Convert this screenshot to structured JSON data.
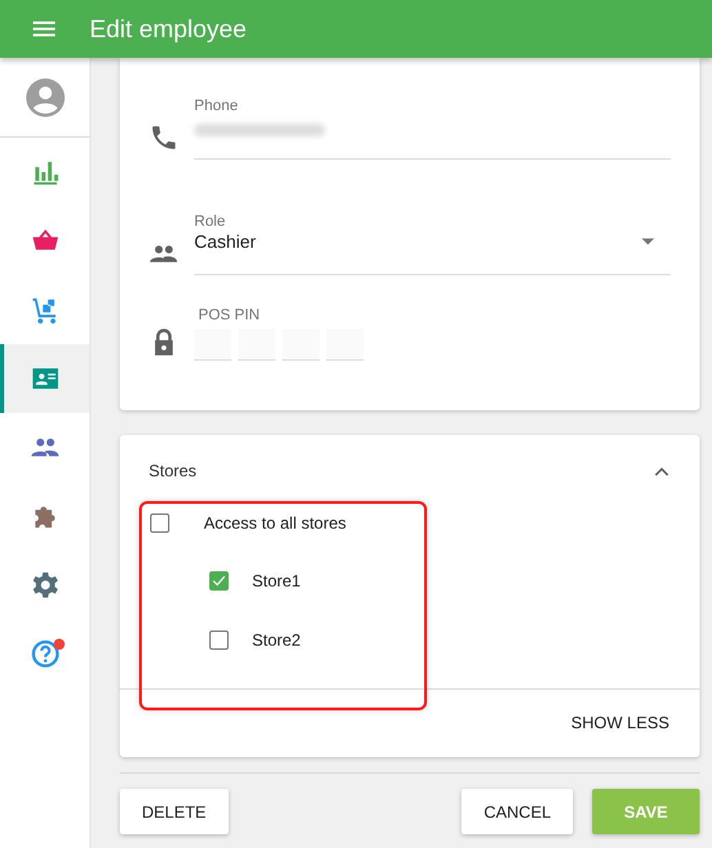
{
  "app_bar": {
    "title": "Edit employee"
  },
  "sidebar": {
    "items": [
      {
        "selected": false,
        "notification": false
      },
      {
        "selected": false,
        "notification": false
      },
      {
        "selected": false,
        "notification": false
      },
      {
        "selected": true,
        "notification": false
      },
      {
        "selected": false,
        "notification": false
      },
      {
        "selected": false,
        "notification": false
      },
      {
        "selected": false,
        "notification": false
      },
      {
        "selected": false,
        "notification": true
      }
    ]
  },
  "details_card": {
    "phone": {
      "label": "Phone"
    },
    "role": {
      "label": "Role",
      "value": "Cashier"
    },
    "pos_pin": {
      "label": "POS PIN"
    }
  },
  "stores_card": {
    "title": "Stores",
    "expanded": true,
    "all_stores": {
      "label": "Access to all stores",
      "checked": false
    },
    "stores": [
      {
        "label": "Store1",
        "checked": true
      },
      {
        "label": "Store2",
        "checked": false
      }
    ],
    "toggle_button": "SHOW LESS"
  },
  "buttons": {
    "delete": "DELETE",
    "cancel": "CANCEL",
    "save": "SAVE"
  }
}
